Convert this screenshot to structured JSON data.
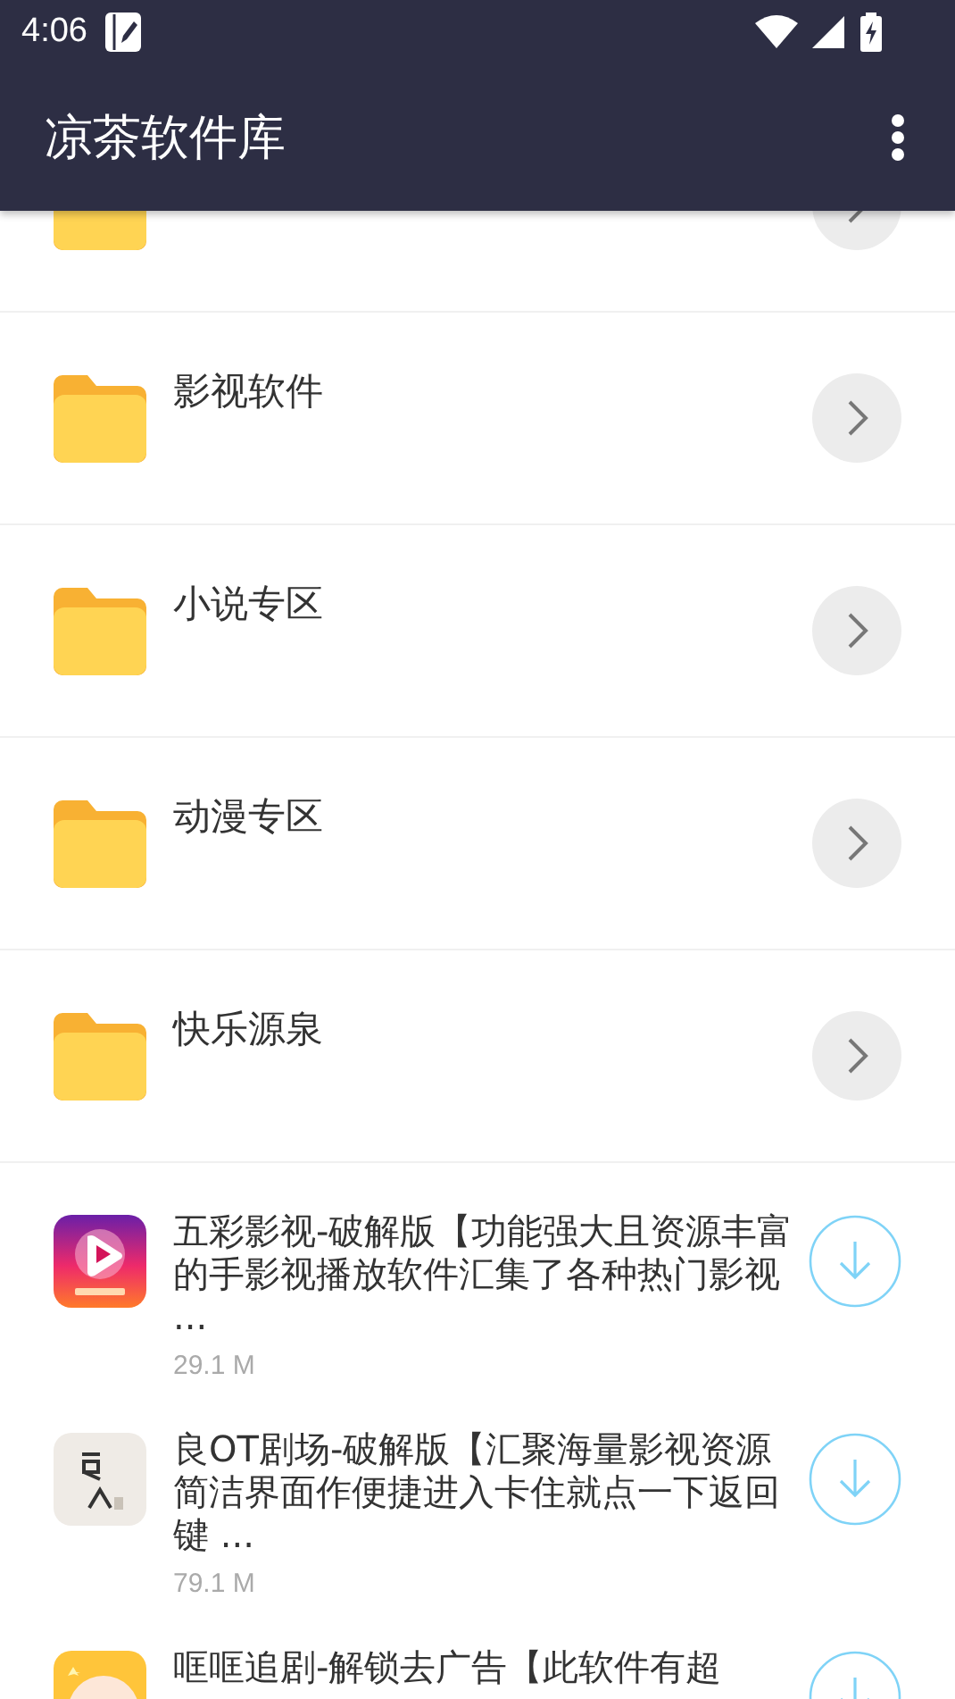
{
  "status_bar": {
    "time": "4:06"
  },
  "app_bar": {
    "title": "凉茶软件库"
  },
  "folders": [
    {
      "name": "影视软件"
    },
    {
      "name": "小说专区"
    },
    {
      "name": "动漫专区"
    },
    {
      "name": "快乐源泉"
    }
  ],
  "apps": [
    {
      "kind": "play",
      "title": "五彩影视-破解版【功能强大且资源丰富的手影视播放软件汇集了各种热门影视 ...",
      "size": "29.1 M"
    },
    {
      "kind": "calligraphy",
      "title": "良OT剧场-破解版【汇聚海量影视资源简洁界面作便捷进入卡住就点一下返回键 ...",
      "size": "79.1 M"
    },
    {
      "kind": "cartoon",
      "title": "哐哐追剧-解锁去广告【此软件有超"
    }
  ]
}
